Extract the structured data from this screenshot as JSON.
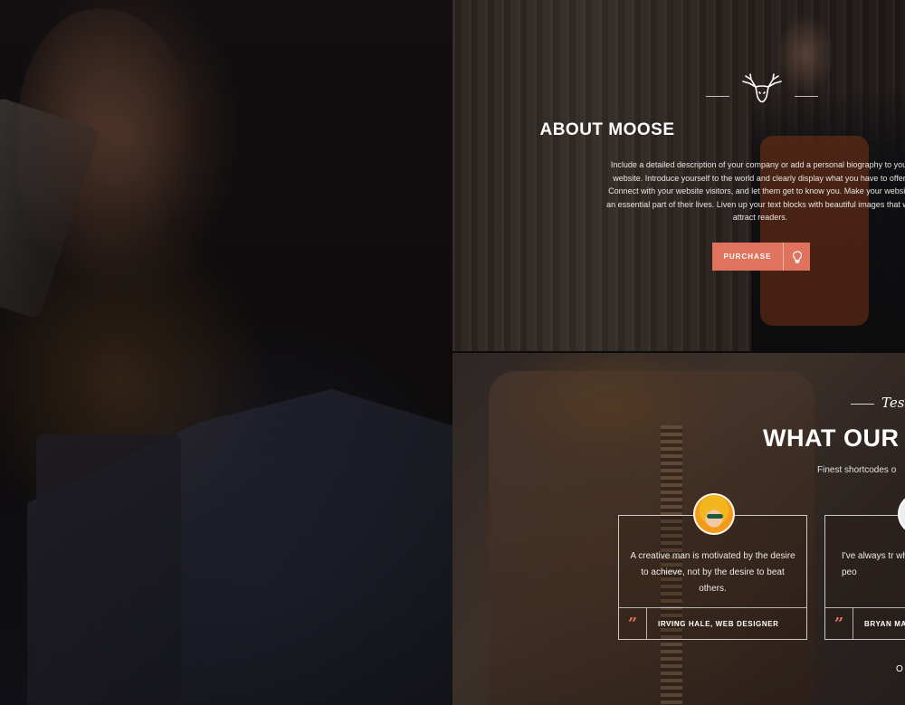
{
  "about": {
    "title": "ABOUT MOOSE",
    "body": "Include a detailed description of your company or add a personal biography to your website. Introduce yourself to the world and clearly display what you have to offer. Connect with your website visitors, and let them get to know you. Make your website an essential part of their lives. Liven up your text blocks with beautiful images that will attract readers.",
    "button_label": "PURCHASE",
    "icon": "lightbulb-icon",
    "logo_icon": "moose-antlers-icon"
  },
  "testimonials": {
    "tag": "Tes",
    "heading": "WHAT OUR",
    "subtitle": "Finest shortcodes o",
    "items": [
      {
        "quote": "A creative man is motivated by the desire to achieve, not by the desire to beat others.",
        "author": "IRVING HALE, WEB DESIGNER"
      },
      {
        "quote": "I've always tr wherever peo",
        "author": "BRYAN MA"
      }
    ],
    "pager": "O"
  },
  "colors": {
    "accent": "#e0735e",
    "overlay_dark": "#0d0b0c"
  }
}
